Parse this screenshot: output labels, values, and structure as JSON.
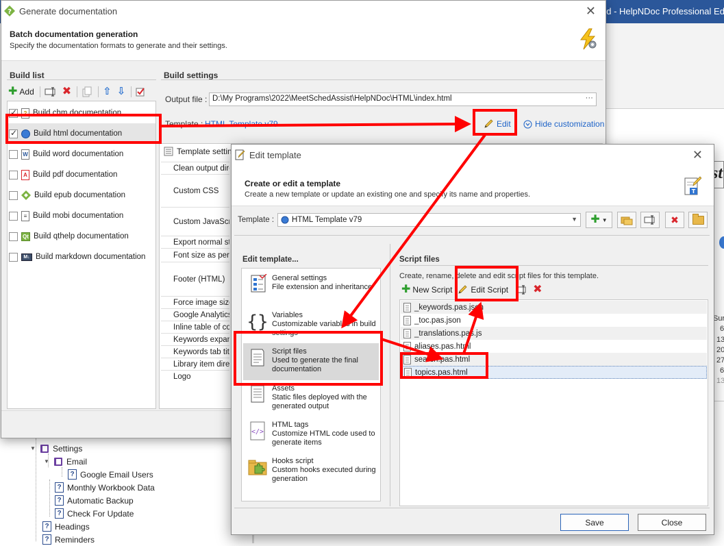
{
  "background_app": {
    "title": "nd - HelpNDoc Professional Edition",
    "editor_text": "st",
    "column_header": "Sur",
    "numbers": [
      "6",
      "13",
      "20",
      "27",
      "6",
      "13"
    ],
    "tree": [
      {
        "label": "Settings",
        "kind": "book"
      },
      {
        "label": "Email",
        "kind": "book"
      },
      {
        "label": "Google Email Users",
        "kind": "topic"
      },
      {
        "label": "Monthly Workbook Data",
        "kind": "topic"
      },
      {
        "label": "Automatic Backup",
        "kind": "topic"
      },
      {
        "label": "Check For Update",
        "kind": "topic"
      },
      {
        "label": "Headings",
        "kind": "topic"
      },
      {
        "label": "Reminders",
        "kind": "topic"
      }
    ]
  },
  "generate_window": {
    "title": "Generate documentation",
    "header_title": "Batch documentation generation",
    "header_subtitle": "Specify the documentation formats to generate and their settings.",
    "build_list_title": "Build list",
    "add_label": "Add",
    "builds": [
      {
        "label": "Build chm documentation",
        "checked": true,
        "icon": "chm-icon"
      },
      {
        "label": "Build html documentation",
        "checked": true,
        "icon": "html-icon",
        "selected": true
      },
      {
        "label": "Build word documentation",
        "checked": false,
        "icon": "word-icon"
      },
      {
        "label": "Build pdf documentation",
        "checked": false,
        "icon": "pdf-icon"
      },
      {
        "label": "Build epub documentation",
        "checked": false,
        "icon": "epub-icon"
      },
      {
        "label": "Build mobi documentation",
        "checked": false,
        "icon": "mobi-icon"
      },
      {
        "label": "Build qthelp documentation",
        "checked": false,
        "icon": "qthelp-icon"
      },
      {
        "label": "Build markdown documentation",
        "checked": false,
        "icon": "markdown-icon"
      }
    ],
    "build_settings_title": "Build settings",
    "output_file_label": "Output file :",
    "output_file_value": "D:\\My Programs\\2022\\MeetSchedAssist\\HelpNDoc\\HTML\\index.html",
    "template_label": "Template :",
    "template_value": "HTML Template v79",
    "edit_label": "Edit",
    "hide_customization_label": "Hide customization",
    "template_settings_tab": "Template settings",
    "properties": [
      "Clean output directory",
      "Custom CSS",
      "Custom JavaScript",
      "Export normal style",
      "Font size as percentage",
      "Footer (HTML)",
      "Force image sizes",
      "Google Analytics ID",
      "Inline table of contents",
      "Keywords expanded",
      "Keywords tab title",
      "Library item directory",
      "Logo"
    ]
  },
  "edit_window": {
    "title": "Edit template",
    "header_title": "Create or edit a template",
    "header_subtitle": "Create a new template or update an existing one and specify its name and properties.",
    "template_label": "Template :",
    "template_value": "HTML Template v79",
    "edit_template_title": "Edit template...",
    "menu": [
      {
        "title": "General settings",
        "desc": "File extension and inheritance",
        "icon": "general-settings-icon"
      },
      {
        "title": "Variables",
        "desc": "Customizable variables in build settings",
        "icon": "variables-icon"
      },
      {
        "title": "Script files",
        "desc": "Used to generate the final documentation",
        "icon": "script-files-icon",
        "selected": true
      },
      {
        "title": "Assets",
        "desc": "Static files deployed with the generated output",
        "icon": "assets-icon"
      },
      {
        "title": "HTML tags",
        "desc": "Customize HTML code used to generate items",
        "icon": "html-tags-icon"
      },
      {
        "title": "Hooks script",
        "desc": "Custom hooks executed during generation",
        "icon": "hooks-script-icon"
      }
    ],
    "script_files_title": "Script files",
    "script_files_desc": "Create, rename, delete and edit script files for this template.",
    "new_script_label": "New Script",
    "edit_script_label": "Edit Script",
    "script_files": [
      "_keywords.pas.json",
      "_toc.pas.json",
      "_translations.pas.js",
      "aliases.pas.html",
      "search.pas.html",
      "topics.pas.html"
    ],
    "selected_script": "topics.pas.html",
    "save_label": "Save",
    "close_label": "Close"
  },
  "colors": {
    "annotation_red": "#ff0000",
    "title_blue": "#2b579a",
    "link_blue": "#1f64c8"
  }
}
